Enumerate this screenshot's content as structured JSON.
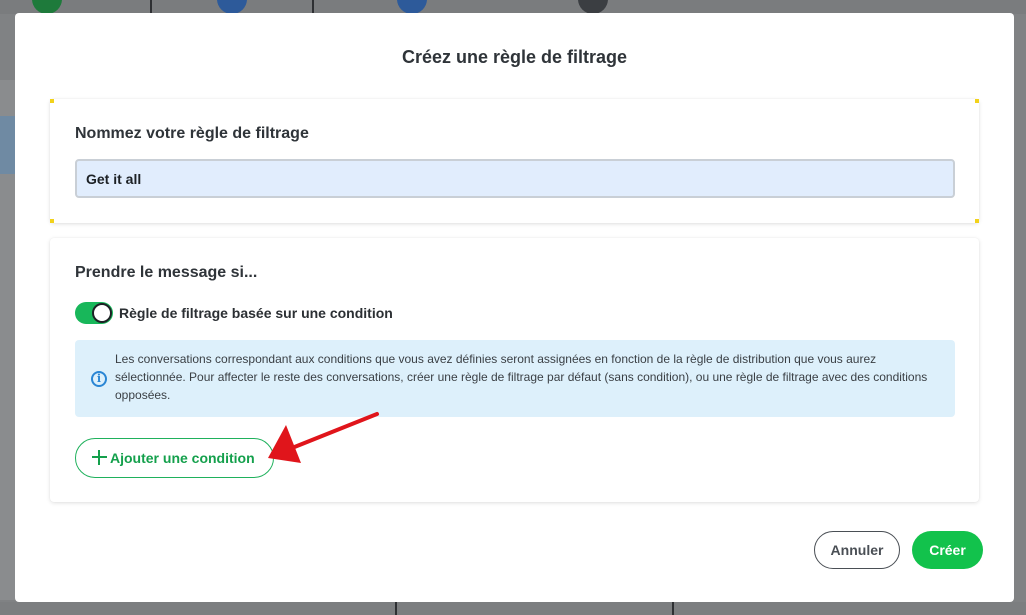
{
  "modal": {
    "title": "Créez une règle de filtrage"
  },
  "name_section": {
    "heading": "Nommez votre règle de filtrage",
    "input_value": "Get it all"
  },
  "condition_section": {
    "heading": "Prendre le message si...",
    "toggle_label": "Règle de filtrage basée sur une condition",
    "toggle_on": true,
    "info_text": "Les conversations correspondant aux conditions que vous avez définies seront assignées en fonction de la règle de distribution que vous aurez sélectionnée. Pour affecter le reste des conversations, créer une règle de filtrage par défaut (sans condition), ou une règle de filtrage avec des conditions opposées.",
    "add_condition_label": "Ajouter une condition"
  },
  "footer": {
    "cancel_label": "Annuler",
    "create_label": "Créer"
  },
  "colors": {
    "accent_green": "#12c24c",
    "annotation_arrow": "#e0151b",
    "info_blue": "#2a86d4"
  },
  "icons": [
    "plus-icon",
    "info-icon",
    "annotation-arrow-icon"
  ]
}
